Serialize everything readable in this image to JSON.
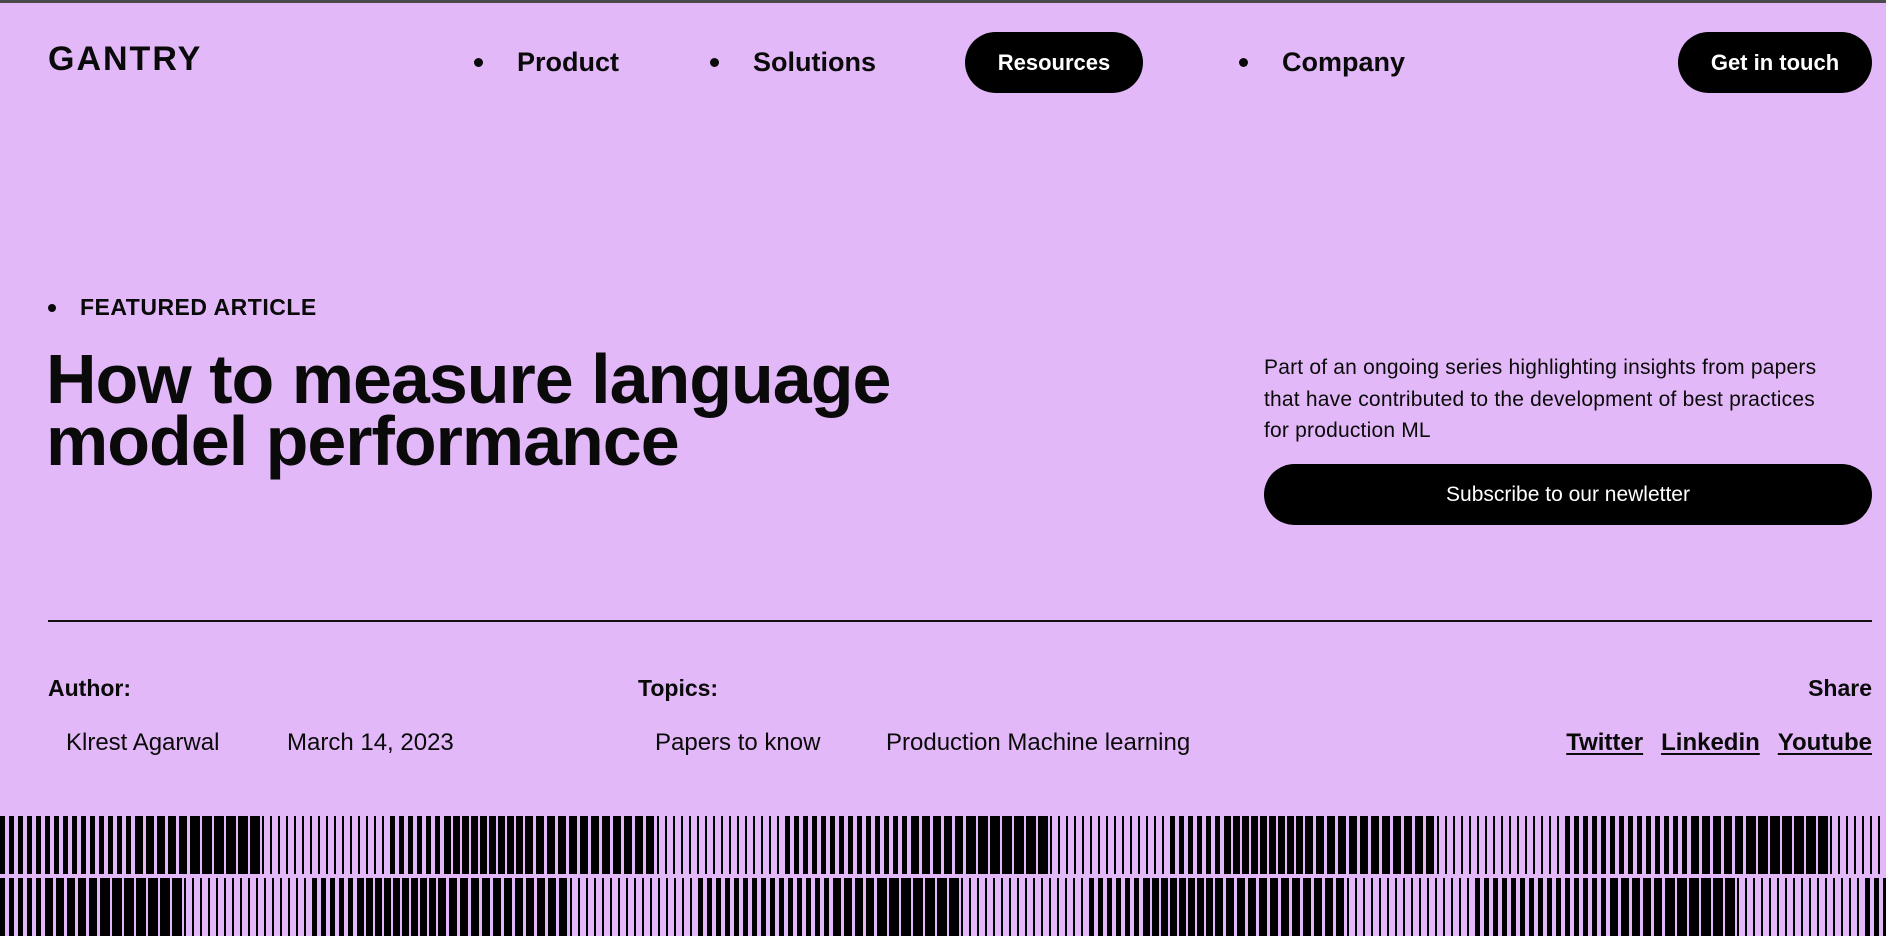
{
  "header": {
    "logo": "GANTRY",
    "nav": [
      {
        "label": "Product"
      },
      {
        "label": "Solutions"
      },
      {
        "label": "Resources"
      },
      {
        "label": "Company"
      }
    ],
    "cta_label": "Get in touch"
  },
  "hero": {
    "eyebrow": "FEATURED ARTICLE",
    "title_line1": "How to measure language",
    "title_line2": "model performance",
    "intro": "Part of an ongoing series highlighting insights from papers that have contributed to the development of best practices for production ML",
    "subscribe_label": "Subscribe to our newletter"
  },
  "meta": {
    "author_label": "Author:",
    "author_name": "Klrest Agarwal",
    "date": "March 14, 2023",
    "topics_label": "Topics:",
    "topics": [
      "Papers to know",
      "Production Machine learning"
    ],
    "share_label": "Share",
    "share_links": [
      "Twitter",
      "Linkedin",
      "Youtube"
    ]
  },
  "colors": {
    "background": "#e2b8f8",
    "ink": "#000000",
    "button_text": "#ffffff"
  }
}
